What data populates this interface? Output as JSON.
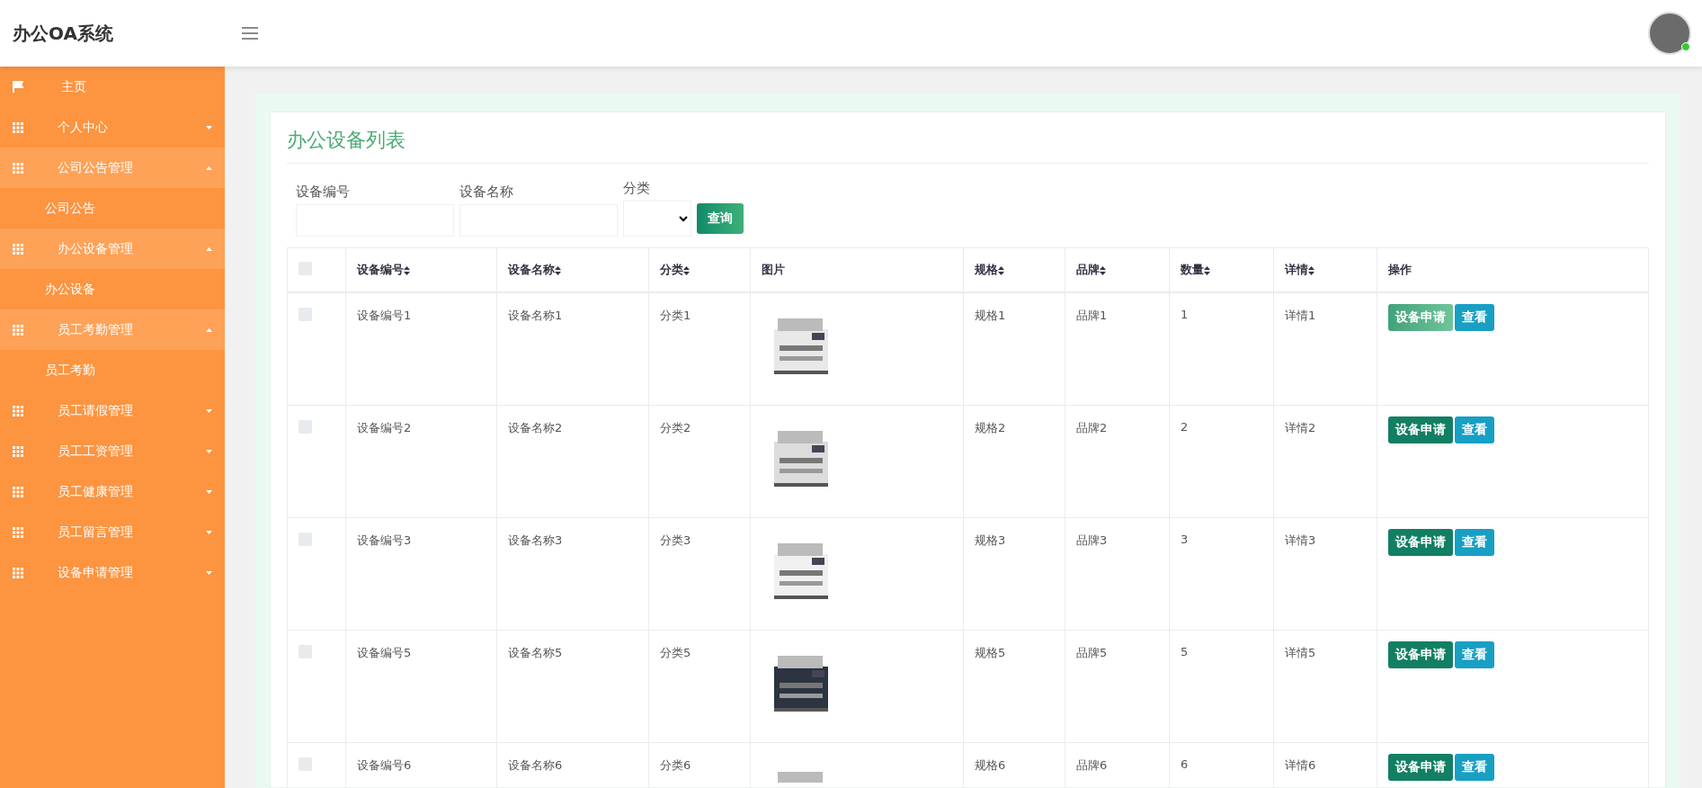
{
  "app": {
    "title": "办公OA系统"
  },
  "sidebar": {
    "items": [
      {
        "kind": "home",
        "label": "主页",
        "expanded": false
      },
      {
        "kind": "group",
        "label": "个人中心",
        "expanded": false
      },
      {
        "kind": "group",
        "label": "公司公告管理",
        "expanded": true
      },
      {
        "kind": "sub",
        "label": "公司公告",
        "expanded": false
      },
      {
        "kind": "group",
        "label": "办公设备管理",
        "expanded": true
      },
      {
        "kind": "sub",
        "label": "办公设备",
        "expanded": false
      },
      {
        "kind": "group",
        "label": "员工考勤管理",
        "expanded": true
      },
      {
        "kind": "sub",
        "label": "员工考勤",
        "expanded": false
      },
      {
        "kind": "group",
        "label": "员工请假管理",
        "expanded": false
      },
      {
        "kind": "group",
        "label": "员工工资管理",
        "expanded": false
      },
      {
        "kind": "group",
        "label": "员工健康管理",
        "expanded": false
      },
      {
        "kind": "group",
        "label": "员工留言管理",
        "expanded": false
      },
      {
        "kind": "group",
        "label": "设备申请管理",
        "expanded": false
      }
    ]
  },
  "page": {
    "title": "办公设备列表"
  },
  "filters": [
    {
      "kind": "input",
      "label": "设备编号"
    },
    {
      "kind": "input",
      "label": "设备名称"
    },
    {
      "kind": "select",
      "label": "分类"
    }
  ],
  "search_button": "查询",
  "table": {
    "select_all": false,
    "columns": [
      {
        "label": "设备编号",
        "sortable": true
      },
      {
        "label": "设备名称",
        "sortable": true
      },
      {
        "label": "分类",
        "sortable": true
      },
      {
        "label": "图片",
        "sortable": false
      },
      {
        "label": "规格",
        "sortable": true
      },
      {
        "label": "品牌",
        "sortable": true
      },
      {
        "label": "数量",
        "sortable": true
      },
      {
        "label": "详情",
        "sortable": true
      },
      {
        "label": "操作",
        "sortable": false
      }
    ],
    "rows": [
      {
        "code": "设备编号1",
        "name": "设备名称1",
        "category": "分类1",
        "spec": "规格1",
        "brand": "品牌1",
        "qty": "1",
        "detail": "详情1",
        "apply": "设备申请",
        "view": "查看",
        "apply_hovered": true,
        "checked": false
      },
      {
        "code": "设备编号2",
        "name": "设备名称2",
        "category": "分类2",
        "spec": "规格2",
        "brand": "品牌2",
        "qty": "2",
        "detail": "详情2",
        "apply": "设备申请",
        "view": "查看",
        "apply_hovered": false,
        "checked": false
      },
      {
        "code": "设备编号3",
        "name": "设备名称3",
        "category": "分类3",
        "spec": "规格3",
        "brand": "品牌3",
        "qty": "3",
        "detail": "详情3",
        "apply": "设备申请",
        "view": "查看",
        "apply_hovered": false,
        "checked": false
      },
      {
        "code": "设备编号5",
        "name": "设备名称5",
        "category": "分类5",
        "spec": "规格5",
        "brand": "品牌5",
        "qty": "5",
        "detail": "详情5",
        "apply": "设备申请",
        "view": "查看",
        "apply_hovered": false,
        "checked": false
      },
      {
        "code": "设备编号6",
        "name": "设备名称6",
        "category": "分类6",
        "spec": "规格6",
        "brand": "品牌6",
        "qty": "6",
        "detail": "详情6",
        "apply": "设备申请",
        "view": "查看",
        "apply_hovered": false,
        "checked": false
      }
    ]
  }
}
